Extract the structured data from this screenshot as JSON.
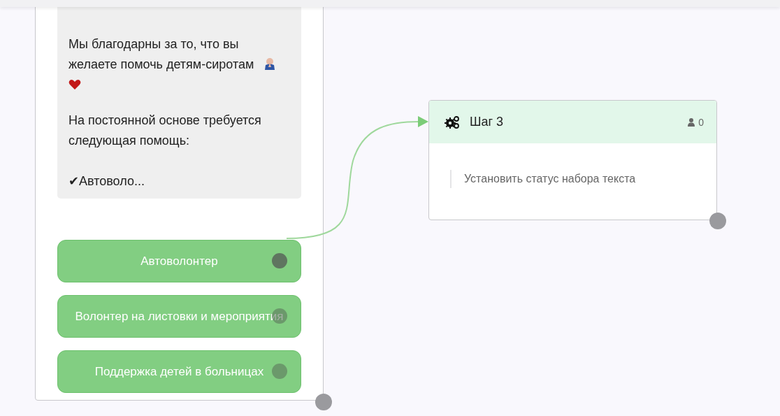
{
  "message_node": {
    "paragraphs": [
      {
        "kind": "with_emoji",
        "text": "Мы благодарны за то, что вы желаете помочь детям-сиротам"
      },
      {
        "kind": "plain",
        "text": "На постоянной основе требуется следующая помощь:"
      },
      {
        "kind": "plain",
        "text": "✔Автоволо..."
      }
    ],
    "buttons": [
      {
        "label": "Автоволонтер",
        "connected": true
      },
      {
        "label": "Волонтер на листовки и мероприятия",
        "connected": false
      },
      {
        "label": "Поддержка детей в больницах",
        "connected": false
      }
    ]
  },
  "step_node": {
    "title": "Шаг 3",
    "count": "0",
    "action": "Установить статус набора текста"
  }
}
